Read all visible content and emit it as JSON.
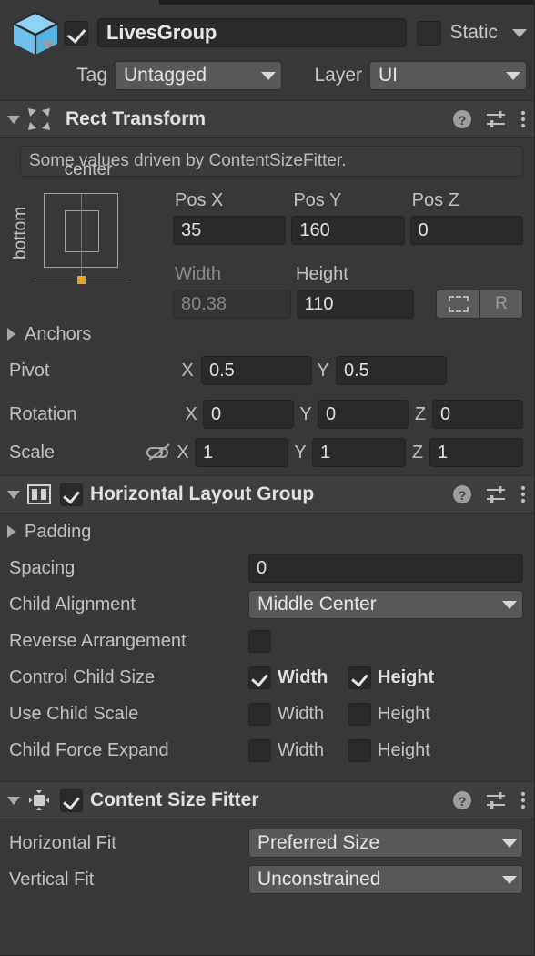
{
  "gameobject": {
    "icon": "cube-icon",
    "enabled_checkbox": true,
    "name": "LivesGroup",
    "static_checkbox": false,
    "static_label": "Static",
    "tag_label": "Tag",
    "tag_value": "Untagged",
    "layer_label": "Layer",
    "layer_value": "UI"
  },
  "rect_transform": {
    "title": "Rect Transform",
    "icon": "rect-transform-icon",
    "expanded": true,
    "help_text": "Some values driven by ContentSizeFitter.",
    "anchor_preset": {
      "top_label": "center",
      "side_label": "bottom",
      "anchor_color": "#e3a62b",
      "guide_color": "#c2564e"
    },
    "pos_headers": [
      "Pos X",
      "Pos Y",
      "Pos Z"
    ],
    "pos_values": [
      "35",
      "160",
      "0"
    ],
    "size_headers": [
      "Width",
      "Height"
    ],
    "size_values": [
      "80.38",
      "110"
    ],
    "width_driven": true,
    "blueprint_button": "blueprint-icon",
    "raw_button": "R",
    "anchors_label": "Anchors",
    "anchors_expanded": false,
    "pivot_label": "Pivot",
    "pivot_axes": [
      "X",
      "Y"
    ],
    "pivot_values": [
      "0.5",
      "0.5"
    ],
    "rotation_label": "Rotation",
    "rotation_axes": [
      "X",
      "Y",
      "Z"
    ],
    "rotation_values": [
      "0",
      "0",
      "0"
    ],
    "scale_label": "Scale",
    "scale_axes": [
      "X",
      "Y",
      "Z"
    ],
    "scale_values": [
      "1",
      "1",
      "1"
    ],
    "scale_link_icon": "link-off-icon"
  },
  "horizontal_layout_group": {
    "title": "Horizontal Layout Group",
    "icon": "horizontal-layout-icon",
    "expanded": true,
    "enabled_checkbox": true,
    "padding_label": "Padding",
    "padding_expanded": false,
    "spacing_label": "Spacing",
    "spacing_value": "0",
    "child_alignment_label": "Child Alignment",
    "child_alignment_value": "Middle Center",
    "reverse_arrangement_label": "Reverse Arrangement",
    "reverse_arrangement_checked": false,
    "control_child_size_label": "Control Child Size",
    "control_child_size": {
      "width_label": "Width",
      "width_checked": true,
      "height_label": "Height",
      "height_checked": true
    },
    "use_child_scale_label": "Use Child Scale",
    "use_child_scale": {
      "width_label": "Width",
      "width_checked": false,
      "height_label": "Height",
      "height_checked": false
    },
    "child_force_expand_label": "Child Force Expand",
    "child_force_expand": {
      "width_label": "Width",
      "width_checked": false,
      "height_label": "Height",
      "height_checked": false
    }
  },
  "content_size_fitter": {
    "title": "Content Size Fitter",
    "icon": "content-size-fitter-icon",
    "expanded": true,
    "enabled_checkbox": true,
    "horizontal_fit_label": "Horizontal Fit",
    "horizontal_fit_value": "Preferred Size",
    "vertical_fit_label": "Vertical Fit",
    "vertical_fit_value": "Unconstrained"
  },
  "tools": {
    "help_icon": "help-icon",
    "preset_icon": "preset-sliders-icon",
    "menu_icon": "kebab-menu-icon"
  },
  "colors": {
    "background": "#383838",
    "header_background": "#3e3e3e",
    "field_background": "#2a2a2a",
    "dropdown_background": "#585858",
    "cube_icon": "#79c8ee",
    "anchor_marker": "#e3a62b",
    "guide_line": "#c2564e"
  }
}
